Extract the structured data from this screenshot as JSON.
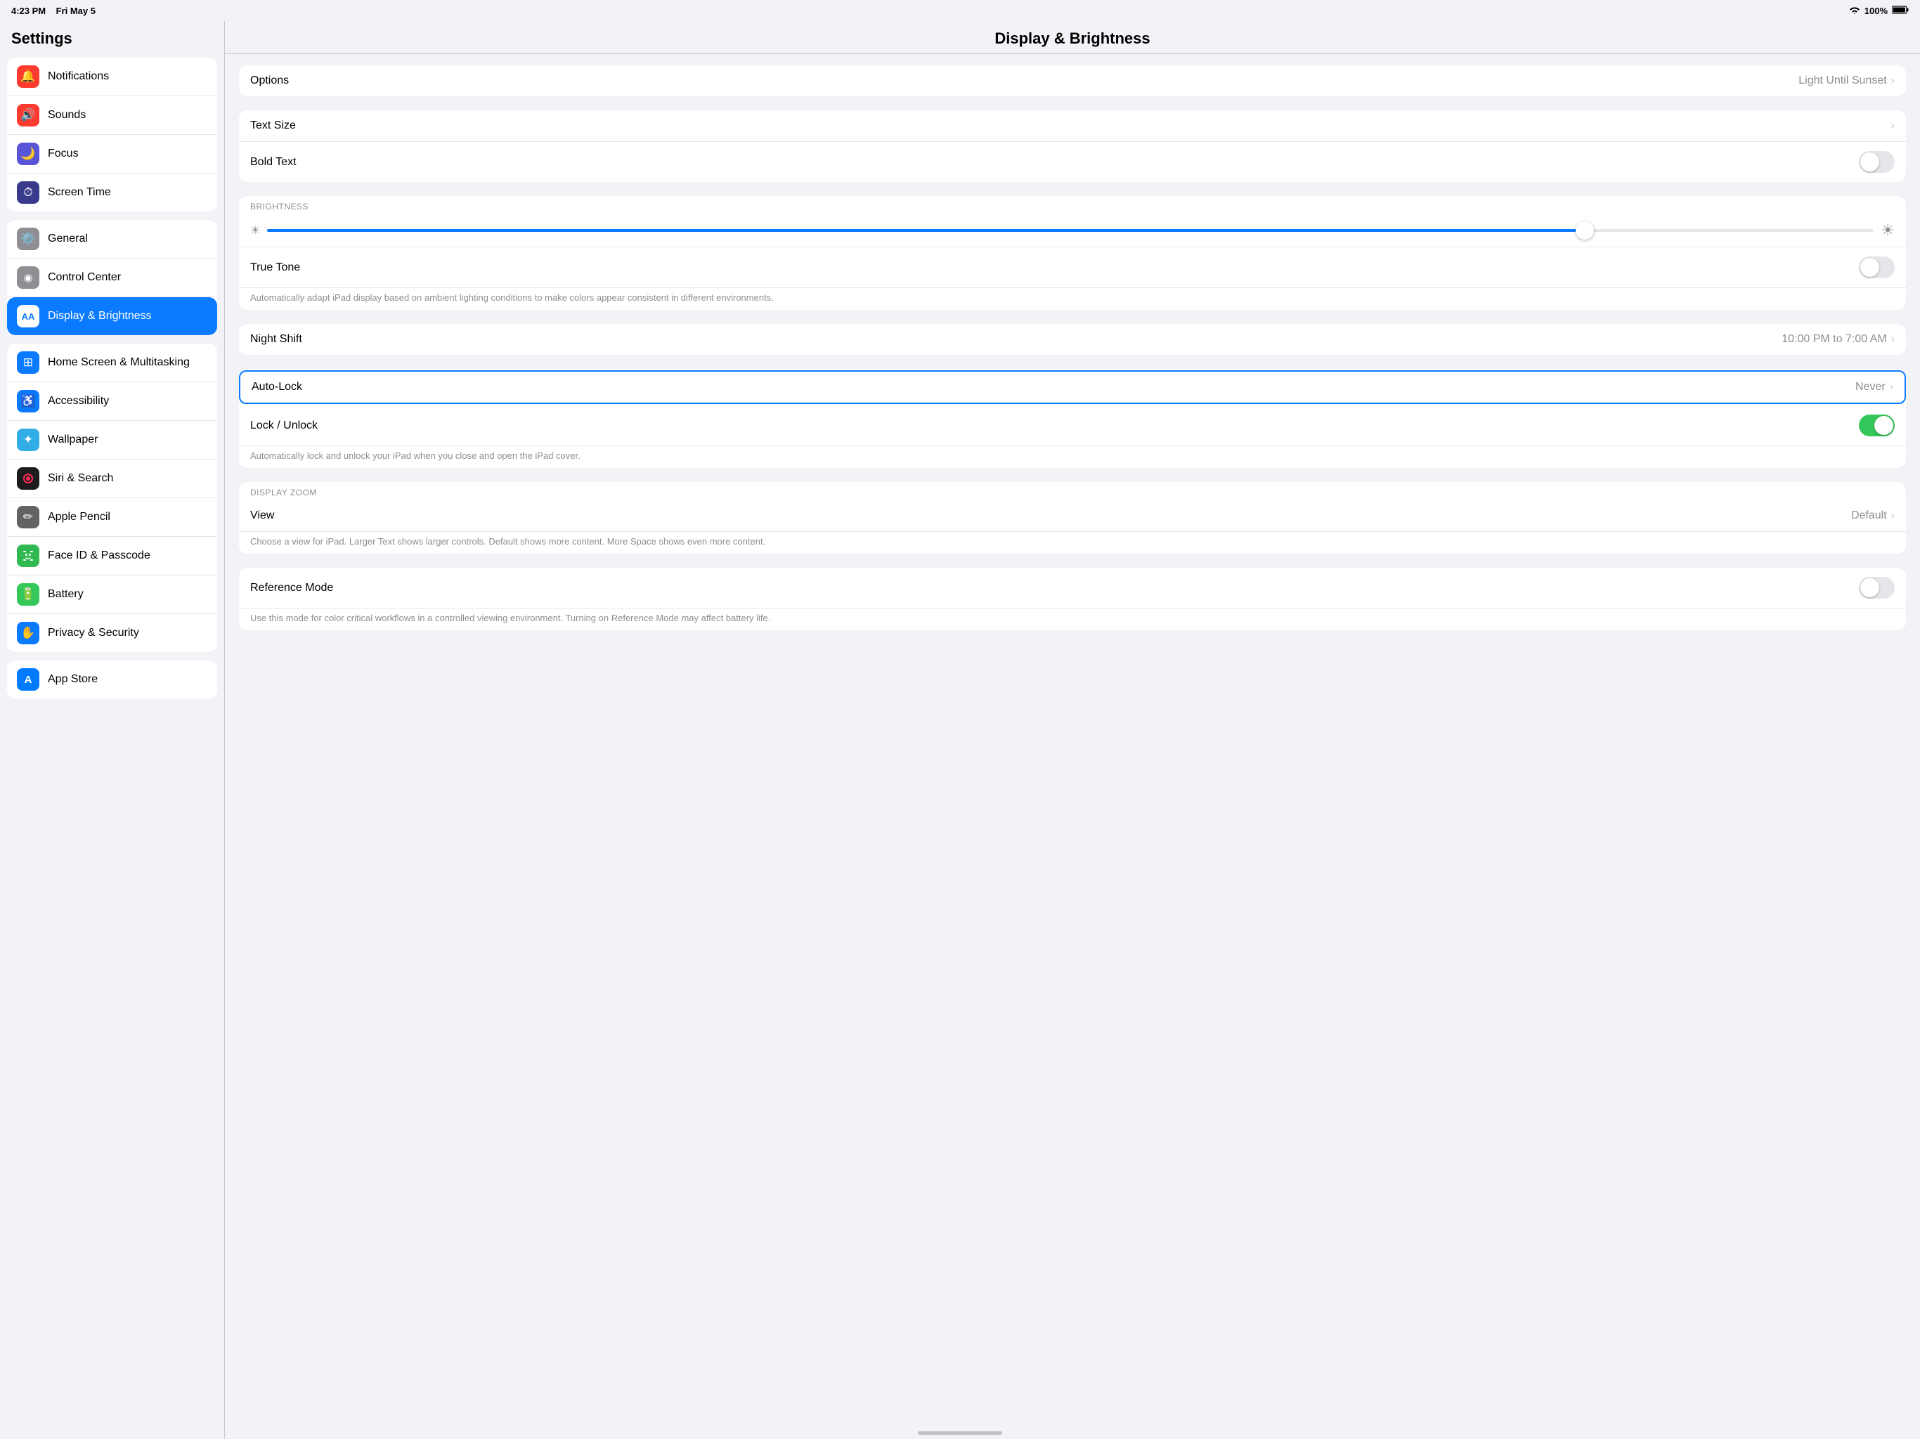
{
  "statusBar": {
    "time": "4:23 PM",
    "date": "Fri May 5",
    "battery": "100%",
    "wifi": true
  },
  "sidebar": {
    "title": "Settings",
    "sections": [
      {
        "id": "top",
        "items": [
          {
            "id": "notifications",
            "label": "Notifications",
            "icon": "🔔",
            "iconBg": "icon-red"
          },
          {
            "id": "sounds",
            "label": "Sounds",
            "icon": "🔊",
            "iconBg": "icon-red"
          },
          {
            "id": "focus",
            "label": "Focus",
            "icon": "🌙",
            "iconBg": "icon-purple-dark"
          },
          {
            "id": "screen-time",
            "label": "Screen Time",
            "icon": "⏱",
            "iconBg": "icon-blue-dark"
          }
        ]
      },
      {
        "id": "middle",
        "items": [
          {
            "id": "general",
            "label": "General",
            "icon": "⚙️",
            "iconBg": "icon-gray"
          },
          {
            "id": "control-center",
            "label": "Control Center",
            "icon": "◉",
            "iconBg": "icon-gray"
          },
          {
            "id": "display-brightness",
            "label": "Display & Brightness",
            "icon": "AA",
            "iconBg": "icon-blue",
            "active": true
          }
        ]
      },
      {
        "id": "lower",
        "items": [
          {
            "id": "home-screen",
            "label": "Home Screen & Multitasking",
            "icon": "⊞",
            "iconBg": "icon-blue"
          },
          {
            "id": "accessibility",
            "label": "Accessibility",
            "icon": "♿",
            "iconBg": "icon-blue"
          },
          {
            "id": "wallpaper",
            "label": "Wallpaper",
            "icon": "✦",
            "iconBg": "icon-cyan"
          },
          {
            "id": "siri-search",
            "label": "Siri & Search",
            "icon": "◉",
            "iconBg": "icon-black"
          },
          {
            "id": "apple-pencil",
            "label": "Apple Pencil",
            "icon": "✏",
            "iconBg": "icon-dark-gray"
          },
          {
            "id": "face-id",
            "label": "Face ID & Passcode",
            "icon": "⊙",
            "iconBg": "icon-green-dark"
          },
          {
            "id": "battery",
            "label": "Battery",
            "icon": "🔋",
            "iconBg": "icon-green"
          },
          {
            "id": "privacy-security",
            "label": "Privacy & Security",
            "icon": "✋",
            "iconBg": "icon-blue"
          }
        ]
      },
      {
        "id": "app-store",
        "items": [
          {
            "id": "app-store",
            "label": "App Store",
            "icon": "A",
            "iconBg": "icon-light-blue"
          }
        ]
      }
    ]
  },
  "content": {
    "title": "Display & Brightness",
    "groups": [
      {
        "id": "appearance",
        "rows": [
          {
            "id": "options",
            "label": "Options",
            "value": "Light Until Sunset",
            "type": "navigate"
          }
        ]
      },
      {
        "id": "text",
        "rows": [
          {
            "id": "text-size",
            "label": "Text Size",
            "value": "",
            "type": "navigate"
          },
          {
            "id": "bold-text",
            "label": "Bold Text",
            "value": "",
            "type": "toggle",
            "toggleState": "off"
          }
        ]
      },
      {
        "id": "brightness",
        "sectionLabel": "BRIGHTNESS",
        "brightnessValue": 82,
        "rows": [
          {
            "id": "true-tone",
            "label": "True Tone",
            "value": "",
            "type": "toggle",
            "toggleState": "off"
          }
        ],
        "trueToneDescription": "Automatically adapt iPad display based on ambient lighting conditions to make colors appear consistent in different environments."
      },
      {
        "id": "night-shift",
        "rows": [
          {
            "id": "night-shift",
            "label": "Night Shift",
            "value": "10:00 PM to 7:00 AM",
            "type": "navigate"
          }
        ]
      },
      {
        "id": "auto-lock",
        "rows": [
          {
            "id": "auto-lock",
            "label": "Auto-Lock",
            "value": "Never",
            "type": "navigate",
            "highlighted": true
          },
          {
            "id": "lock-unlock",
            "label": "Lock / Unlock",
            "value": "",
            "type": "toggle",
            "toggleState": "on"
          }
        ],
        "lockDescription": "Automatically lock and unlock your iPad when you close and open the iPad cover."
      },
      {
        "id": "display-zoom",
        "sectionLabel": "DISPLAY ZOOM",
        "rows": [
          {
            "id": "view",
            "label": "View",
            "value": "Default",
            "type": "navigate"
          }
        ],
        "viewDescription": "Choose a view for iPad. Larger Text shows larger controls. Default shows more content. More Space shows even more content."
      },
      {
        "id": "reference-mode",
        "rows": [
          {
            "id": "reference-mode",
            "label": "Reference Mode",
            "value": "",
            "type": "toggle",
            "toggleState": "off"
          }
        ],
        "referenceModeDescription": "Use this mode for color critical workflows in a controlled viewing environment. Turning on Reference Mode may affect battery life."
      }
    ]
  }
}
